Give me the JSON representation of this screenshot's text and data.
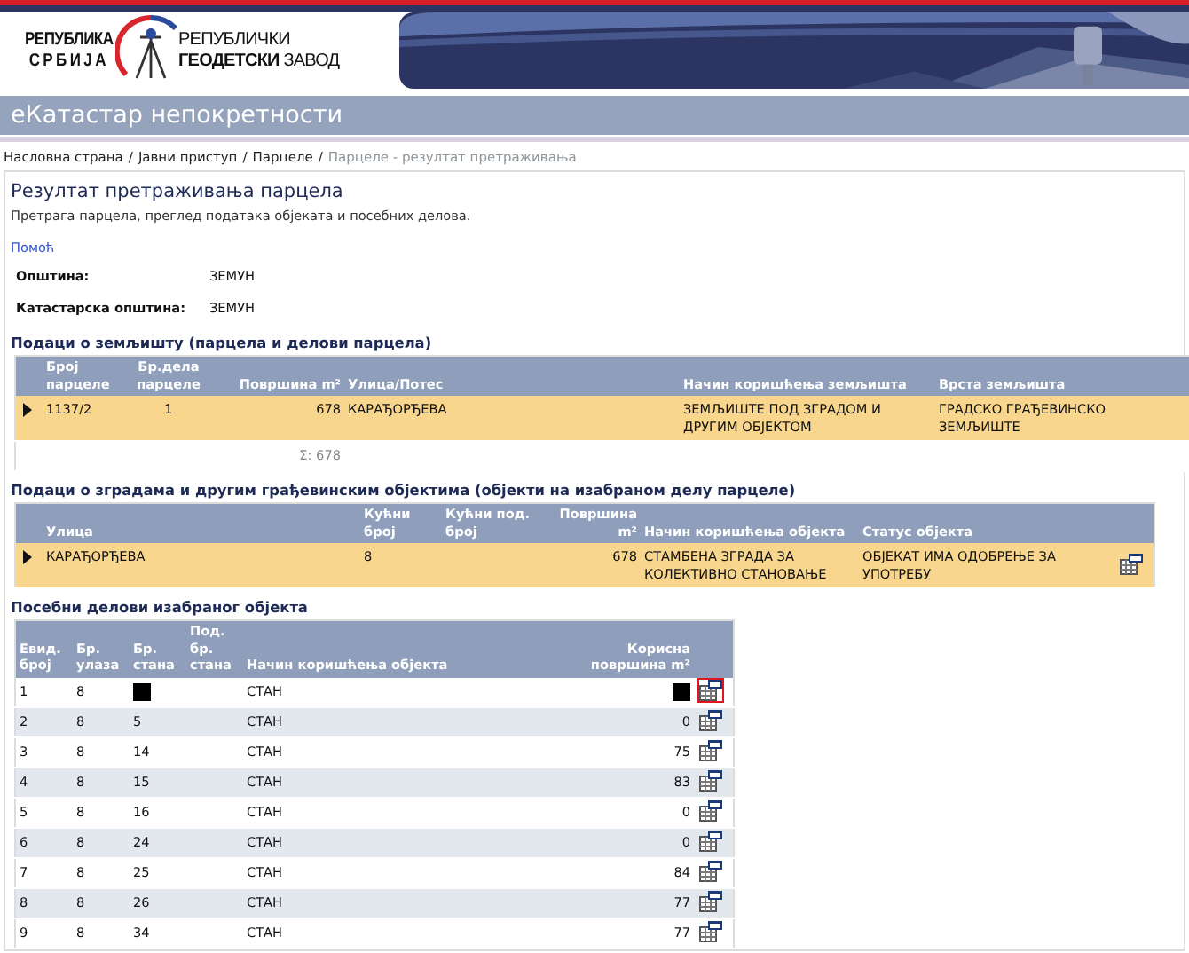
{
  "header": {
    "left_logo": [
      "РЕПУБЛИКА",
      "СРБИЈА"
    ],
    "right_logo": [
      "РЕПУБЛИЧКИ",
      "**ГЕОДЕТСКИ** ЗАВОД"
    ],
    "banner": {
      "kind": "picture"
    }
  },
  "app_title": "еКатастар непокретности",
  "breadcrumb": {
    "separator": "/",
    "items": [
      {
        "label": "Насловна страна",
        "current": false
      },
      {
        "label": "Јавни приступ",
        "current": false
      },
      {
        "label": "Парцеле",
        "current": false
      },
      {
        "label": "Парцеле - резултат претраживања",
        "current": true
      }
    ]
  },
  "page": {
    "title": "Резултат претраживања парцела",
    "subtitle": "Претрага парцела, преглед података објеката и посебних делова.",
    "help_link": "Помоћ",
    "fields": [
      {
        "label": "Општина:",
        "value": "ЗЕМУН"
      },
      {
        "label": "Катастарска општина:",
        "value": "ЗЕМУН"
      }
    ]
  },
  "sections": [
    {
      "title": "Подаци о земљишту (парцела и делови парцела)",
      "columns": [
        "Број парцеле",
        "Бр.дела парцеле",
        "Површина m²",
        "Улица/Потес",
        "Начин коришћења земљишта",
        "Врста земљишта"
      ],
      "rows": [
        {
          "selected": true,
          "highlighted": false,
          "cells": [
            {
              "text": "1137/2",
              "redacted": false
            },
            {
              "text": "1",
              "redacted": false
            },
            {
              "text": "678",
              "redacted": false
            },
            {
              "text": "КАРАЂОРЂЕВА",
              "redacted": false
            },
            {
              "text": "ЗЕМЉИШТЕ ПОД ЗГРАДОМ И ДРУГИМ ОБЈЕКТОМ",
              "redacted": false
            },
            {
              "text": "ГРАДСКО ГРАЂЕВИНСКО ЗЕМЉИШТЕ",
              "redacted": false
            }
          ]
        }
      ],
      "total": "Σ: 678"
    },
    {
      "title": "Подаци о зградама и другим грађевинским објектима (објекти на изабраном делу парцеле)",
      "columns": [
        "Улица",
        "Кућни број",
        "Кућни под. број",
        "Површина m²",
        "Начин коришћења објекта",
        "Статус објекта"
      ],
      "rows": [
        {
          "selected": true,
          "highlighted": false,
          "cells": [
            {
              "text": "КАРАЂОРЂЕВА",
              "redacted": false
            },
            {
              "text": "8",
              "redacted": false
            },
            {
              "redacted": false
            },
            {
              "text": "678",
              "redacted": false
            },
            {
              "text": "СТАМБЕНА ЗГРАДА ЗА КОЛЕКТИВНО СТАНОВАЊЕ",
              "redacted": false
            },
            {
              "text": "ОБЈЕКАТ ИМА ОДОБРЕЊЕ ЗА УПОТРЕБУ",
              "redacted": false
            }
          ]
        }
      ]
    },
    {
      "title": "Посебни делови изабраног објекта",
      "columns": [
        "Евид. број",
        "Бр. улаза",
        "Бр. стана",
        "Под. бр. стана",
        "Начин коришћења објекта",
        "Корисна површина m²"
      ],
      "rows": [
        {
          "selected": false,
          "highlighted": true,
          "cells": [
            {
              "text": "1",
              "redacted": false
            },
            {
              "text": "8",
              "redacted": false
            },
            {
              "redacted": true
            },
            {
              "redacted": false
            },
            {
              "text": "СТАН",
              "redacted": false
            },
            {
              "redacted": true
            }
          ]
        },
        {
          "selected": false,
          "highlighted": false,
          "cells": [
            {
              "text": "2",
              "redacted": false
            },
            {
              "text": "8",
              "redacted": false
            },
            {
              "text": "5",
              "redacted": false
            },
            {
              "redacted": false
            },
            {
              "text": "СТАН",
              "redacted": false
            },
            {
              "text": "0",
              "redacted": false
            }
          ]
        },
        {
          "selected": false,
          "highlighted": false,
          "cells": [
            {
              "text": "3",
              "redacted": false
            },
            {
              "text": "8",
              "redacted": false
            },
            {
              "text": "14",
              "redacted": false
            },
            {
              "redacted": false
            },
            {
              "text": "СТАН",
              "redacted": false
            },
            {
              "text": "75",
              "redacted": false
            }
          ]
        },
        {
          "selected": false,
          "highlighted": false,
          "cells": [
            {
              "text": "4",
              "redacted": false
            },
            {
              "text": "8",
              "redacted": false
            },
            {
              "text": "15",
              "redacted": false
            },
            {
              "redacted": false
            },
            {
              "text": "СТАН",
              "redacted": false
            },
            {
              "text": "83",
              "redacted": false
            }
          ]
        },
        {
          "selected": false,
          "highlighted": false,
          "cells": [
            {
              "text": "5",
              "redacted": false
            },
            {
              "text": "8",
              "redacted": false
            },
            {
              "text": "16",
              "redacted": false
            },
            {
              "redacted": false
            },
            {
              "text": "СТАН",
              "redacted": false
            },
            {
              "text": "0",
              "redacted": false
            }
          ]
        },
        {
          "selected": false,
          "highlighted": false,
          "cells": [
            {
              "text": "6",
              "redacted": false
            },
            {
              "text": "8",
              "redacted": false
            },
            {
              "text": "24",
              "redacted": false
            },
            {
              "redacted": false
            },
            {
              "text": "СТАН",
              "redacted": false
            },
            {
              "text": "0",
              "redacted": false
            }
          ]
        },
        {
          "selected": false,
          "highlighted": false,
          "cells": [
            {
              "text": "7",
              "redacted": false
            },
            {
              "text": "8",
              "redacted": false
            },
            {
              "text": "25",
              "redacted": false
            },
            {
              "redacted": false
            },
            {
              "text": "СТАН",
              "redacted": false
            },
            {
              "text": "84",
              "redacted": false
            }
          ]
        },
        {
          "selected": false,
          "highlighted": false,
          "cells": [
            {
              "text": "8",
              "redacted": false
            },
            {
              "text": "8",
              "redacted": false
            },
            {
              "text": "26",
              "redacted": false
            },
            {
              "redacted": false
            },
            {
              "text": "СТАН",
              "redacted": false
            },
            {
              "text": "77",
              "redacted": false
            }
          ]
        },
        {
          "selected": false,
          "highlighted": false,
          "cells": [
            {
              "text": "9",
              "redacted": false
            },
            {
              "text": "8",
              "redacted": false
            },
            {
              "text": "34",
              "redacted": false
            },
            {
              "redacted": false
            },
            {
              "text": "СТАН",
              "redacted": false
            },
            {
              "text": "77",
              "redacted": false
            }
          ]
        }
      ]
    }
  ]
}
